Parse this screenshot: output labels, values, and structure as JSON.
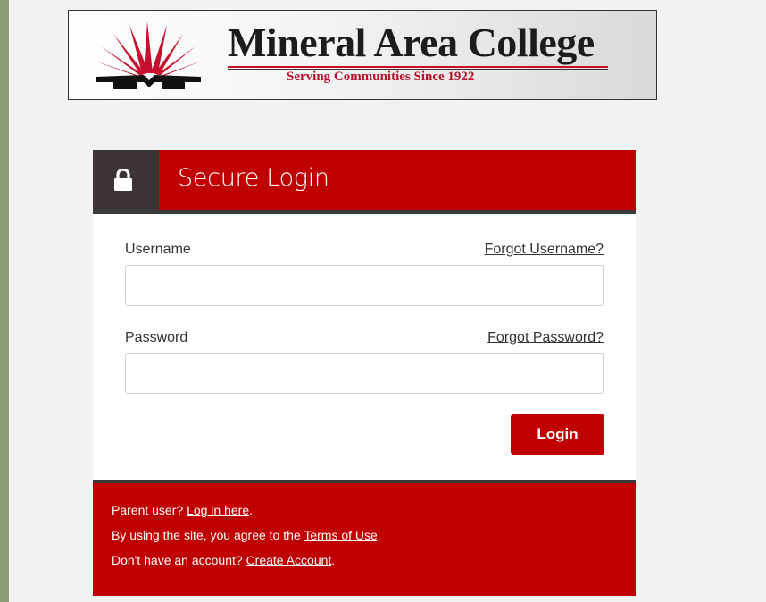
{
  "logo": {
    "college_name": "Mineral Area College",
    "tagline": "Serving Communities Since 1922"
  },
  "login": {
    "title": "Secure Login",
    "lock_icon": "lock-icon",
    "username_label": "Username",
    "forgot_username": "Forgot Username?",
    "username_value": "",
    "password_label": "Password",
    "forgot_password": "Forgot Password?",
    "password_value": "",
    "login_button": "Login"
  },
  "footer": {
    "parent_prefix": "Parent user? ",
    "parent_link": "Log in here",
    "parent_suffix": ".",
    "terms_prefix": "By using the site, you agree to the ",
    "terms_link": "Terms of Use",
    "terms_suffix": ".",
    "account_prefix": "Don't have an account? ",
    "account_link": "Create Account",
    "account_suffix": "."
  },
  "colors": {
    "accent_red": "#c00000",
    "header_dark": "#3d3535",
    "outer_frame": "#8c9c74"
  }
}
